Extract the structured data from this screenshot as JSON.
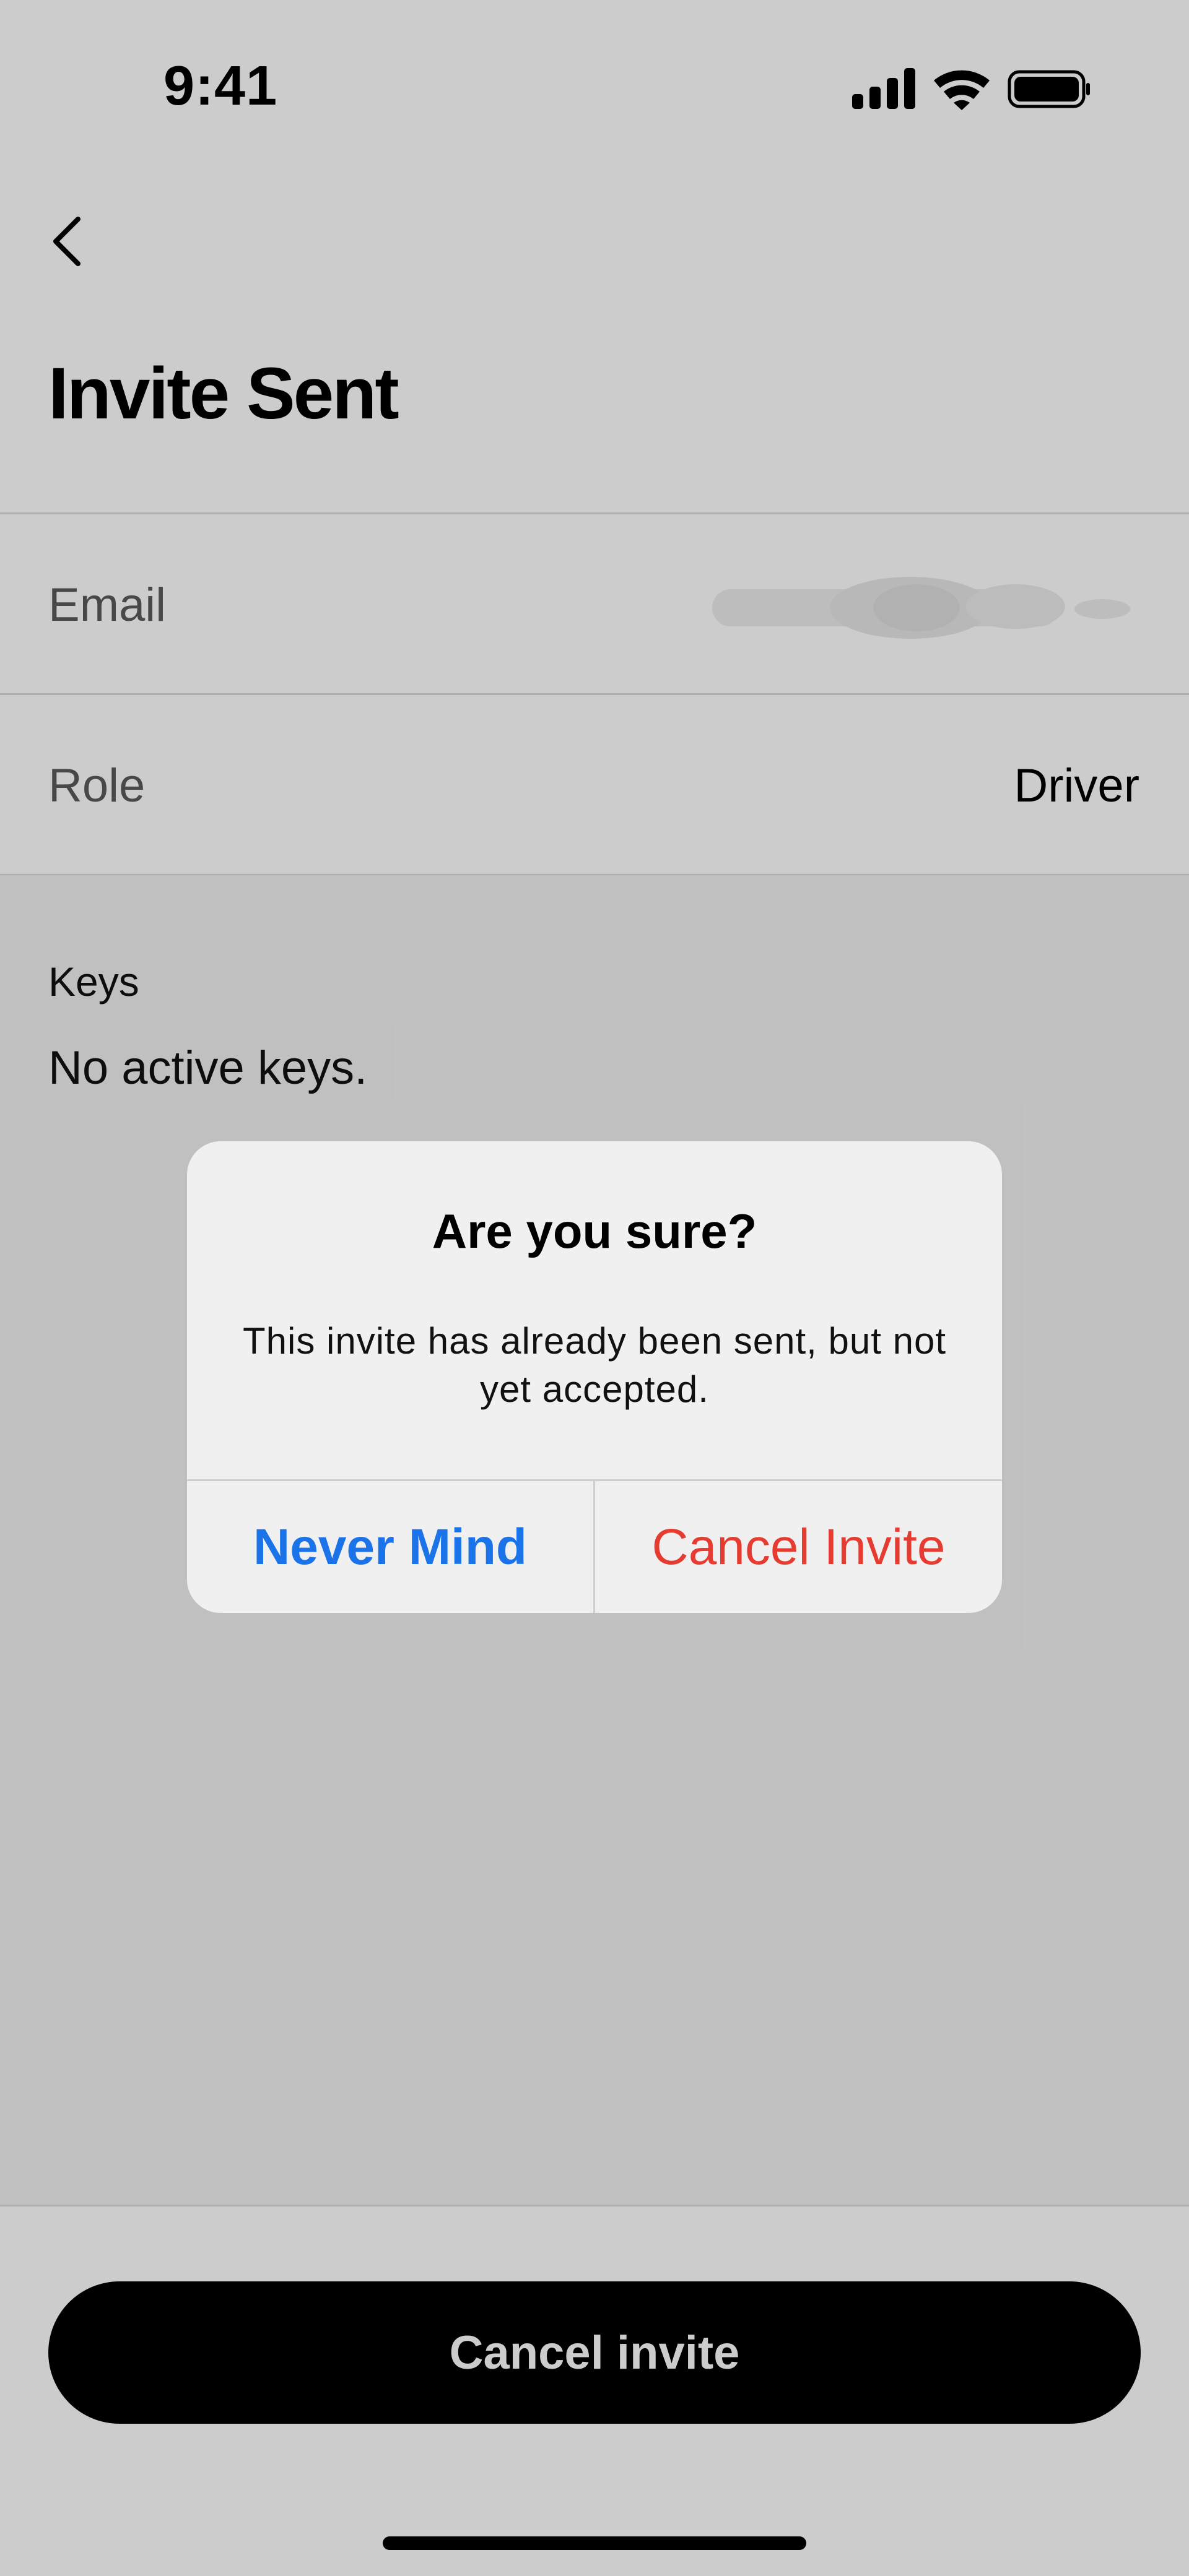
{
  "status_bar": {
    "time": "9:41"
  },
  "header": {
    "title": "Invite Sent"
  },
  "details": {
    "email_label": "Email",
    "role_label": "Role",
    "role_value": "Driver"
  },
  "keys": {
    "label": "Keys",
    "empty_text": "No active keys."
  },
  "footer": {
    "cancel_button": "Cancel invite"
  },
  "alert": {
    "title": "Are you sure?",
    "message": "This invite has already been sent, but not yet accepted.",
    "secondary_button": "Never Mind",
    "destructive_button": "Cancel Invite"
  },
  "colors": {
    "accent_blue": "#1a73e8",
    "destructive_red": "#e63b30"
  }
}
